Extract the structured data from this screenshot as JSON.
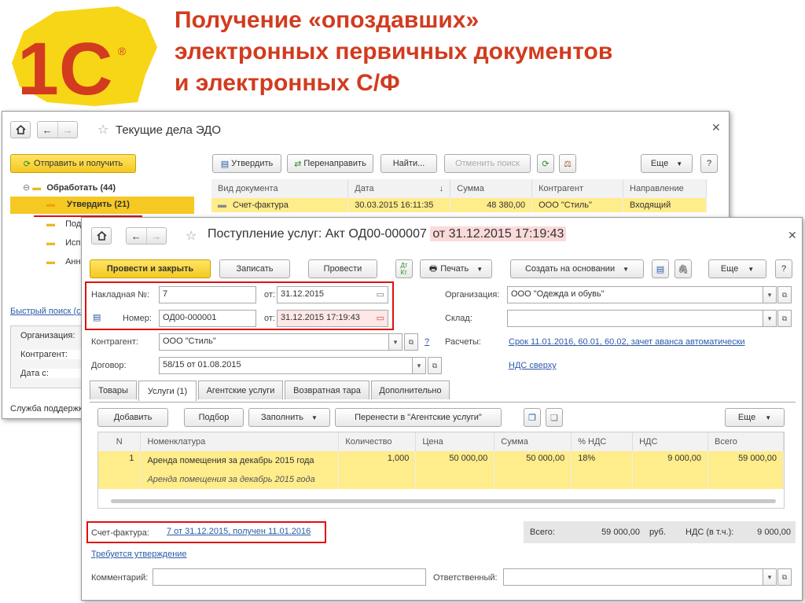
{
  "slide": {
    "title_lines": [
      "Получение «опоздавших»",
      "электронных первичных документов",
      "и электронных С/Ф"
    ]
  },
  "logo": {
    "text": "1С",
    "registered": "®"
  },
  "back_window": {
    "title": "Текущие дела ЭДО",
    "send_receive": "Отправить и получить",
    "tree": {
      "root": "Обработать (44)",
      "items": [
        "Утвердить (21)",
        "Под",
        "Исп",
        "Анн"
      ]
    },
    "quick_search": "Быстрый поиск (ск",
    "filters": [
      "Организация:",
      "Контрагент:",
      "Дата с:"
    ],
    "support": "Служба поддержк",
    "toolbar": {
      "approve": "Утвердить",
      "redirect": "Перенаправить",
      "find": "Найти...",
      "cancel_search": "Отменить поиск",
      "more": "Еще",
      "help": "?"
    },
    "columns": [
      "Вид документа",
      "Дата",
      "Сумма",
      "Контрагент",
      "Направление"
    ],
    "sort_indicator": "↓",
    "row": {
      "type": "Счет-фактура",
      "date": "30.03.2015 16:11:35",
      "sum": "48 380,00",
      "counterparty": "ООО \"Стиль\"",
      "direction": "Входящий"
    }
  },
  "front_window": {
    "title_main": "Поступление услуг: Акт ОД00-000007",
    "title_date": "от 31.12.2015 17:19:43",
    "toolbar": {
      "post_close": "Провести и закрыть",
      "save": "Записать",
      "post": "Провести",
      "print": "Печать",
      "create_based": "Создать на основании",
      "more": "Еще",
      "help": "?"
    },
    "waybill": {
      "label": "Накладная  №:",
      "number": "7",
      "date_label": "от:",
      "date": "31.12.2015"
    },
    "number": {
      "label": "Номер:",
      "value": "ОД00-000001",
      "date_label": "от:",
      "date": "31.12.2015 17:19:43"
    },
    "organization": {
      "label": "Организация:",
      "value": "ООО \"Одежда и обувь\""
    },
    "warehouse": {
      "label": "Склад:",
      "value": ""
    },
    "counterparty": {
      "label": "Контрагент:",
      "value": "ООО \"Стиль\"",
      "help": "?"
    },
    "settlements": {
      "label": "Расчеты:",
      "value": "Срок 11.01.2016, 60.01, 60.02, зачет аванса автоматически"
    },
    "contract": {
      "label": "Договор:",
      "value": "58/15 от 01.08.2015"
    },
    "vat_link": "НДС сверху",
    "tabs": [
      "Товары",
      "Услуги (1)",
      "Агентские услуги",
      "Возвратная тара",
      "Дополнительно"
    ],
    "table_toolbar": {
      "add": "Добавить",
      "select": "Подбор",
      "fill": "Заполнить",
      "move": "Перенести в \"Агентские услуги\"",
      "more": "Еще"
    },
    "columns": [
      "N",
      "Номенклатура",
      "Количество",
      "Цена",
      "Сумма",
      "% НДС",
      "НДС",
      "Всего"
    ],
    "row": {
      "n": "1",
      "name": "Аренда помещения за декабрь 2015 года",
      "content": "Аренда помещения за декабрь 2015 года",
      "qty": "1,000",
      "price": "50 000,00",
      "sum": "50 000,00",
      "vat_rate": "18%",
      "vat": "9 000,00",
      "total": "59 000,00"
    },
    "invoice": {
      "label": "Счет-фактура:",
      "value": "7 от 31.12.2015, получен 11.01.2016"
    },
    "totals": {
      "total_label": "Всего:",
      "total": "59 000,00",
      "currency": "руб.",
      "vat_label": "НДС (в т.ч.):",
      "vat": "9 000,00"
    },
    "approval_link": "Требуется утверждение",
    "comment_label": "Комментарий:",
    "comment": "",
    "responsible_label": "Ответственный:",
    "responsible": ""
  },
  "colors": {
    "title": "#d23b1f",
    "highlight": "#ffec8b",
    "accent_yellow": "#f5c823",
    "redbox": "#e01010",
    "link": "#2a5aa8"
  }
}
